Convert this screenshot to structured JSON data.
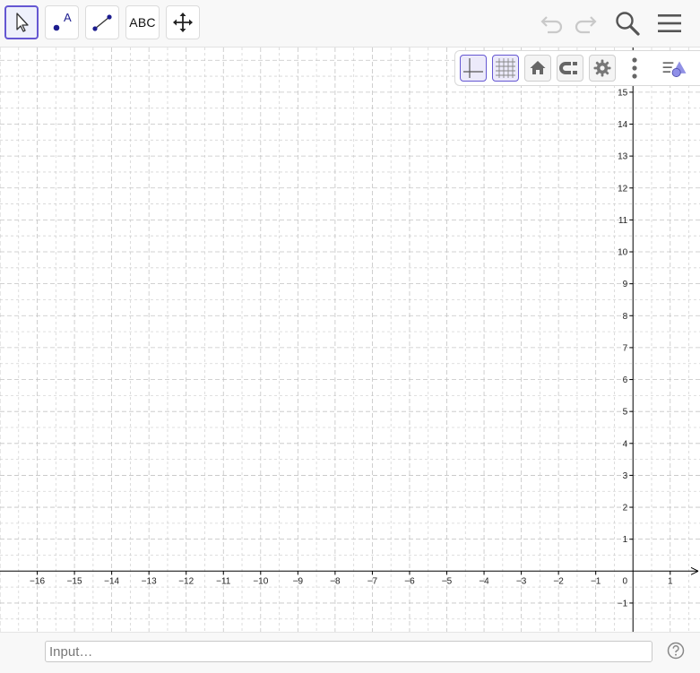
{
  "toolbar": {
    "tools": [
      {
        "id": "move",
        "icon": "arrow-cursor-icon",
        "selected": true
      },
      {
        "id": "point",
        "icon": "point-icon",
        "label": "A",
        "selected": false
      },
      {
        "id": "segment",
        "icon": "segment-icon",
        "selected": false
      },
      {
        "id": "text",
        "icon": "text-tool-icon",
        "label": "ABC",
        "selected": false
      },
      {
        "id": "move-graphics",
        "icon": "move-graphics-view-icon",
        "selected": false
      }
    ],
    "right_icons": [
      "undo-icon",
      "redo-icon",
      "search-icon",
      "hamburger-menu-icon"
    ]
  },
  "graphics_style_bar": {
    "buttons": [
      "axes-toggle-icon",
      "grid-toggle-icon",
      "home-view-icon",
      "magnet-snap-icon",
      "settings-gear-icon",
      "more-vertical-icon",
      "style-bar-toggle-icon"
    ],
    "axes_on": true,
    "grid_on": true
  },
  "chart_data": {
    "type": "table",
    "xlim": [
      -17,
      1.8
    ],
    "ylim": [
      -1.9,
      16.4
    ],
    "x_ticks": [
      -16,
      -15,
      -14,
      -13,
      -12,
      -11,
      -10,
      -9,
      -8,
      -7,
      -6,
      -5,
      -4,
      -3,
      -2,
      -1,
      0,
      1
    ],
    "y_ticks": [
      -1,
      1,
      2,
      3,
      4,
      5,
      6,
      7,
      8,
      9,
      10,
      11,
      12,
      13,
      14,
      15
    ],
    "origin_label": "0",
    "grid": true,
    "grid_style": "dashed"
  },
  "input_bar": {
    "placeholder": "Input…",
    "value": ""
  },
  "colors": {
    "accent": "#6557d2",
    "grid": "#c4c4c4",
    "axis": "#000000",
    "toolbar_bg": "#f8f8f8"
  }
}
